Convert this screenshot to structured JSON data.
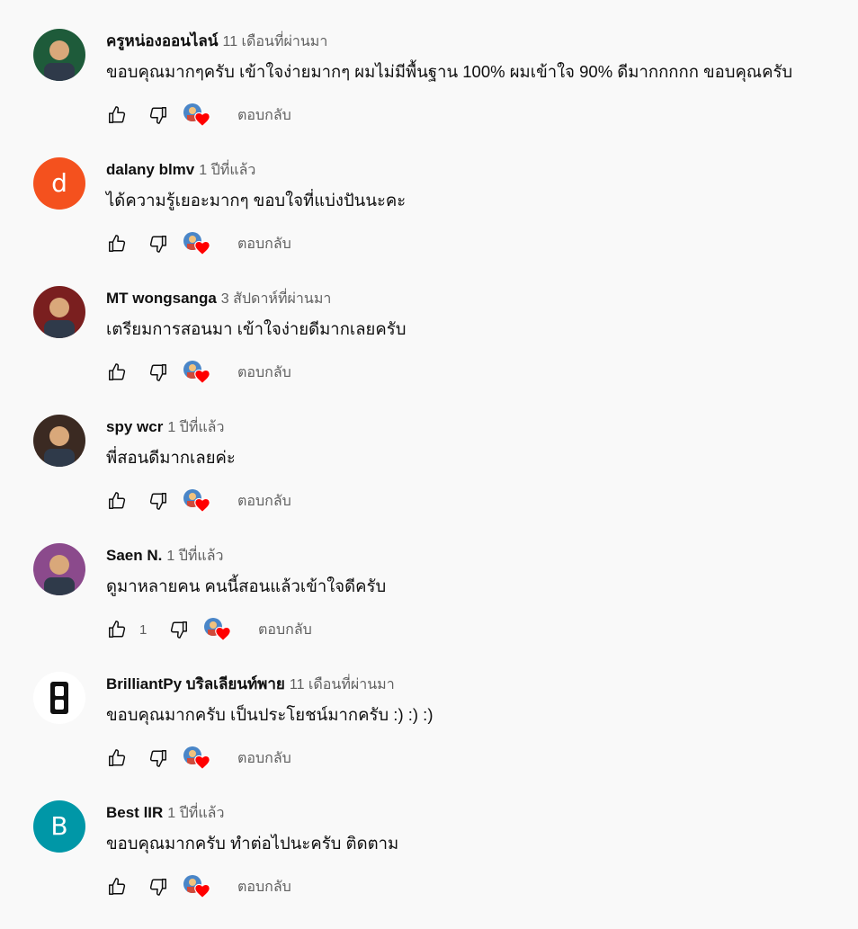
{
  "comments": [
    {
      "author": "ครูหน่องออนไลน์",
      "time": "11 เดือนที่ผ่านมา",
      "text": "ขอบคุณมากๆครับ เข้าใจง่ายมากๆ ผมไม่มีพื้นฐาน 100% ผมเข้าใจ 90% ดีมากกกกก ขอบคุณครับ",
      "likes": "",
      "reply": "ตอบกลับ",
      "avatar_type": "image",
      "avatar_color": "#1e5b3a"
    },
    {
      "author": "dalany blmv",
      "time": "1 ปีที่แล้ว",
      "text": "ได้ความรู้เยอะมากๆ ขอบใจที่แบ่งปันนะคะ",
      "likes": "",
      "reply": "ตอบกลับ",
      "avatar_type": "letter",
      "avatar_letter": "d",
      "avatar_color": "#f4511e"
    },
    {
      "author": "MT wongsanga",
      "time": "3 สัปดาห์ที่ผ่านมา",
      "text": "เตรียมการสอนมา เข้าใจง่ายดีมากเลยครับ",
      "likes": "",
      "reply": "ตอบกลับ",
      "avatar_type": "image",
      "avatar_color": "#7a1f1f"
    },
    {
      "author": "spy wcr",
      "time": "1 ปีที่แล้ว",
      "text": "พี่สอนดีมากเลยค่ะ",
      "likes": "",
      "reply": "ตอบกลับ",
      "avatar_type": "image",
      "avatar_color": "#3b2a22"
    },
    {
      "author": "Saen N.",
      "time": "1 ปีที่แล้ว",
      "text": "ดูมาหลายคน คนนี้สอนแล้วเข้าใจดีครับ",
      "likes": "1",
      "reply": "ตอบกลับ",
      "avatar_type": "image",
      "avatar_color": "#8b4a8c"
    },
    {
      "author": "BrilliantPy บริลเลียนท์พาย",
      "time": "11 เดือนที่ผ่านมา",
      "text": "ขอบคุณมากครับ เป็นประโยชน์มากครับ :) :) :)",
      "likes": "",
      "reply": "ตอบกลับ",
      "avatar_type": "logo",
      "avatar_color": "#ffffff"
    },
    {
      "author": "Best lIR",
      "time": "1 ปีที่แล้ว",
      "text": "ขอบคุณมากครับ ทำต่อไปนะครับ ติดตาม",
      "likes": "",
      "reply": "ตอบกลับ",
      "avatar_type": "letter",
      "avatar_letter": "B",
      "avatar_color": "#0097a7"
    }
  ],
  "icons": {
    "like": "thumb-up-outline-icon",
    "dislike": "thumb-down-outline-icon",
    "creator_heart": "creator-heart-icon",
    "heart_color": "#ff0000"
  }
}
